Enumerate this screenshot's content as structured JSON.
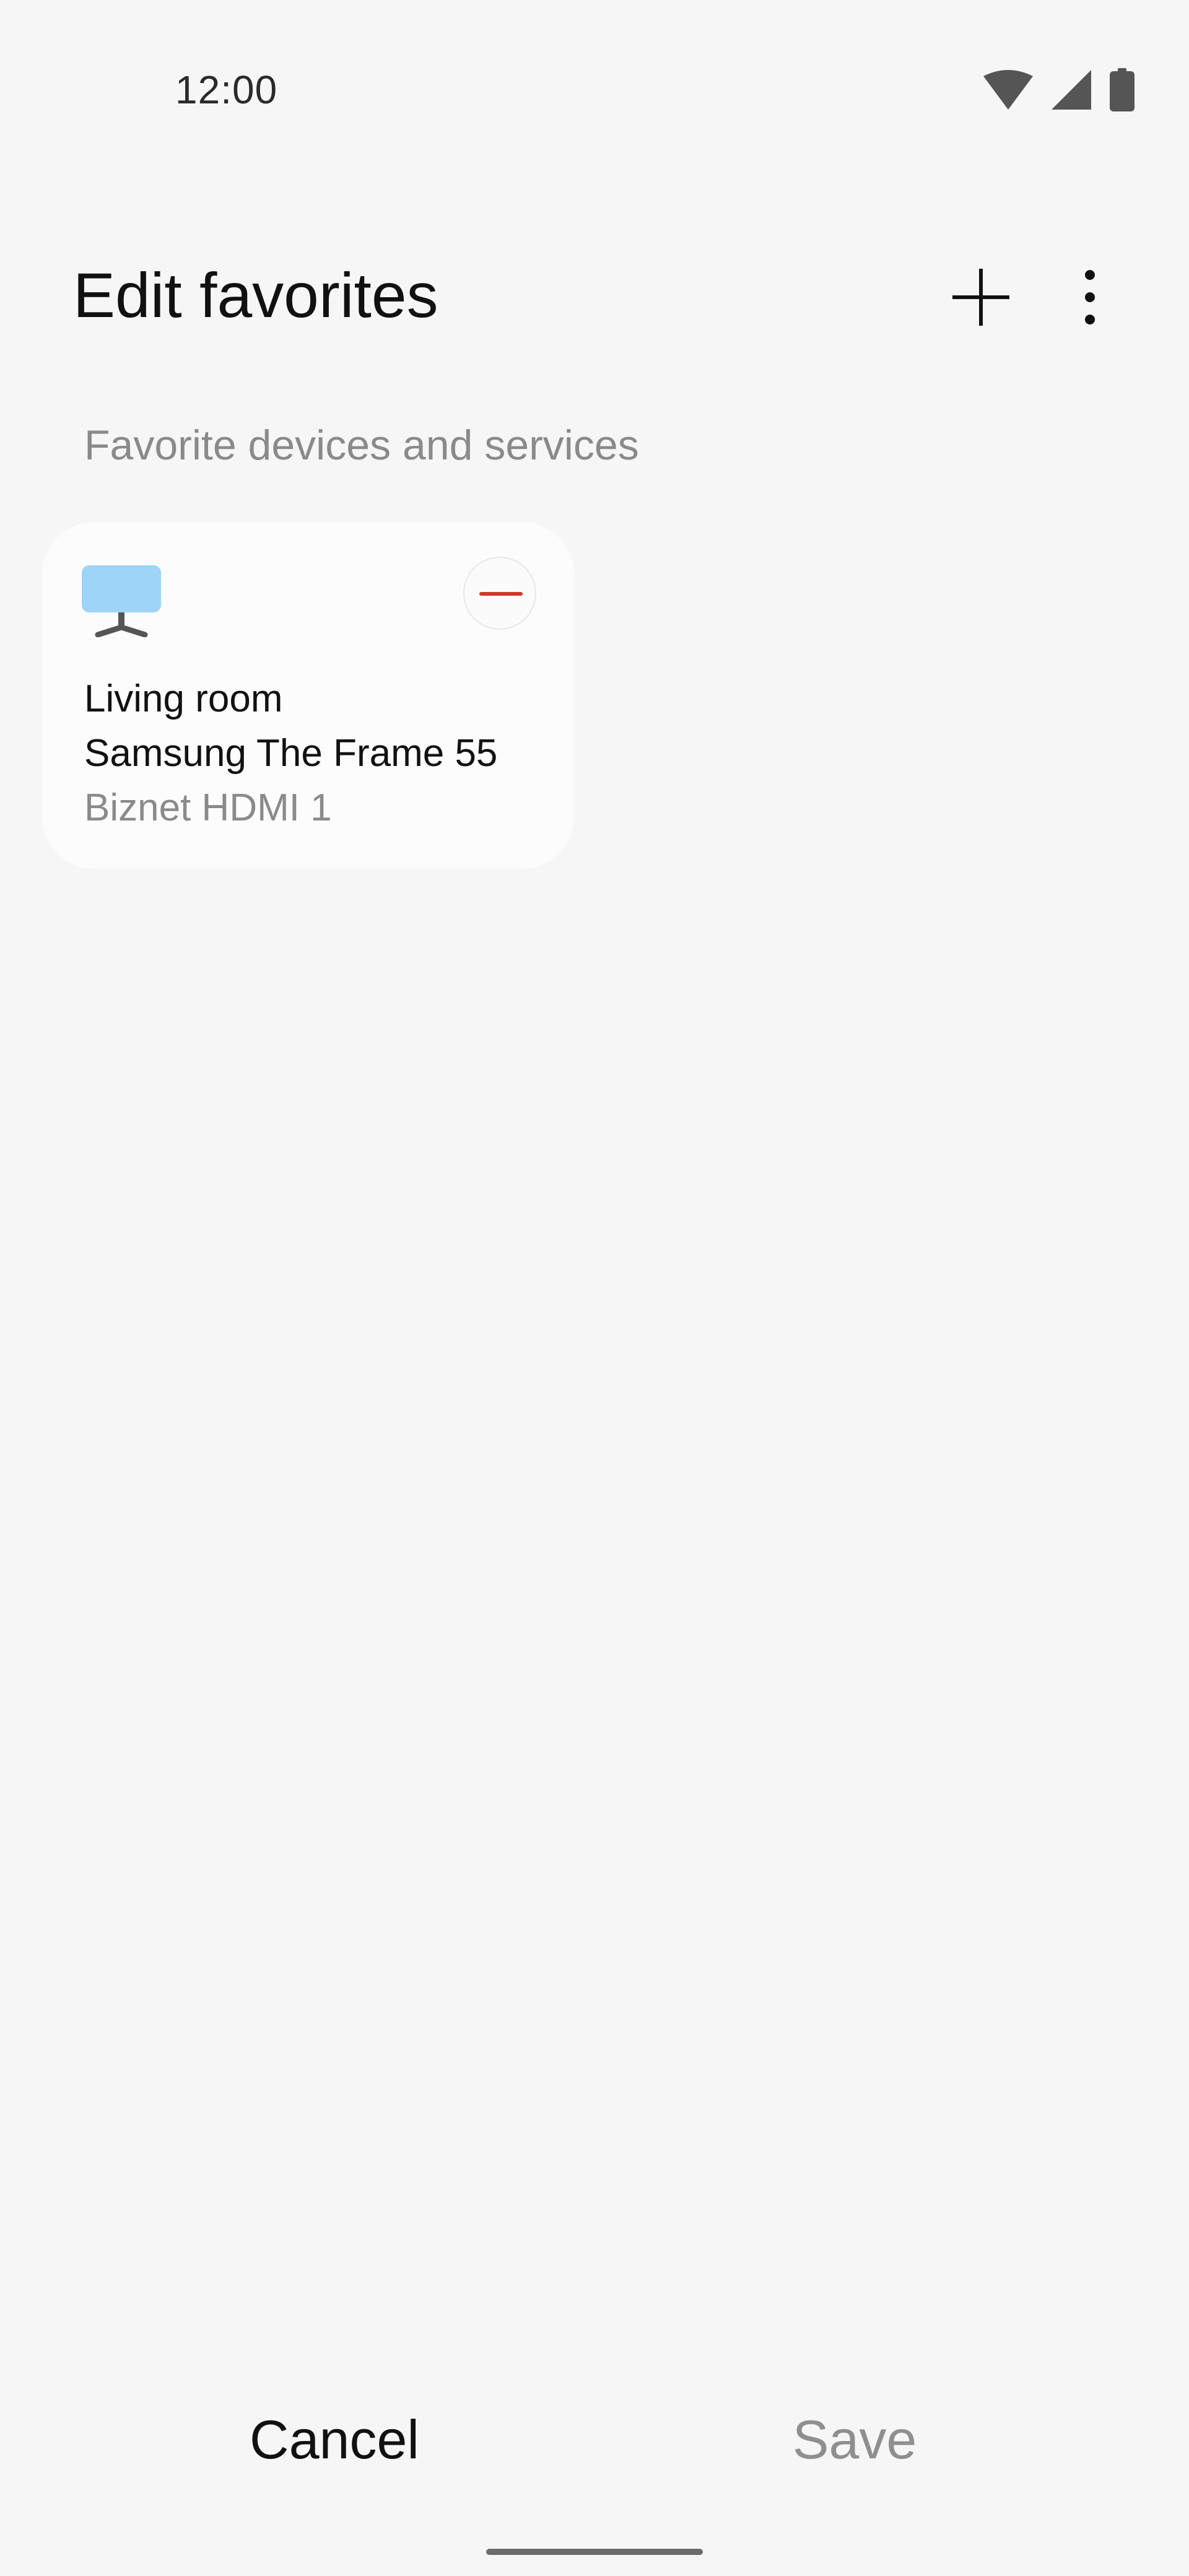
{
  "status_bar": {
    "time": "12:00",
    "icons": [
      "wifi-icon",
      "signal-icon",
      "battery-icon"
    ]
  },
  "header": {
    "title": "Edit favorites",
    "actions": [
      "add-icon",
      "more-vert-icon"
    ]
  },
  "section": {
    "label": "Favorite devices and services"
  },
  "favorite_card": {
    "icon": "tv-icon",
    "room": "Living room",
    "device_name": "Samsung The Frame 55",
    "source": "Biznet HDMI 1",
    "remove_icon": "remove-icon"
  },
  "bottom_actions": {
    "cancel_label": "Cancel",
    "save_label": "Save"
  },
  "colors": {
    "background": "#f6f6f6",
    "card": "#fcfcfd",
    "remove_accent": "#cc3a2a",
    "tv_screen": "#9ed4f7",
    "muted_text": "#8a8a8a"
  }
}
